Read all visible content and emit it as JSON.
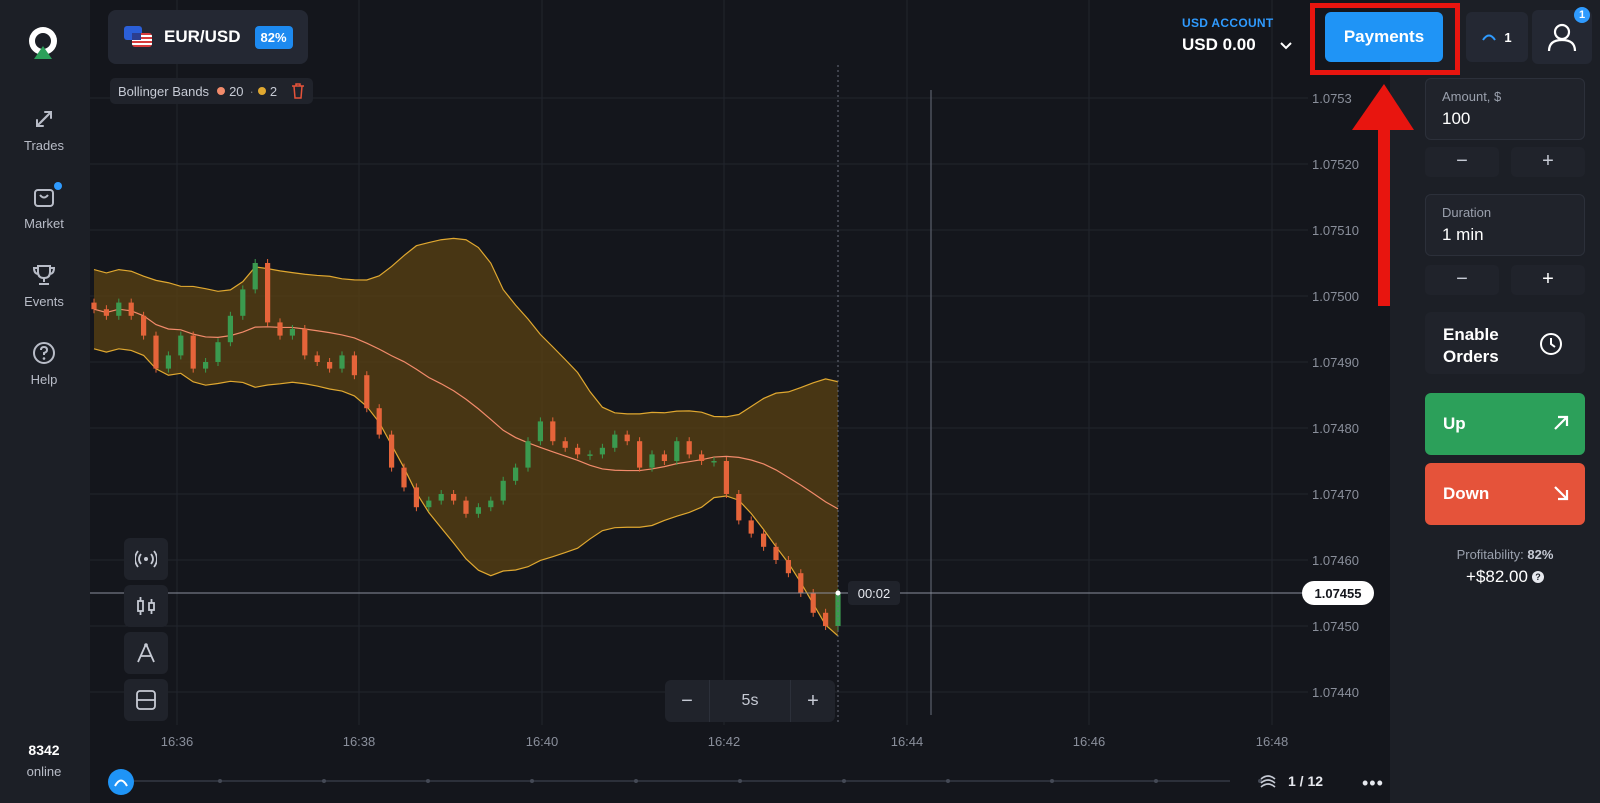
{
  "sidebar": {
    "items": [
      {
        "label": "Trades",
        "icon": "trades-arrows-icon"
      },
      {
        "label": "Market",
        "icon": "shopping-bag-icon"
      },
      {
        "label": "Events",
        "icon": "trophy-icon"
      },
      {
        "label": "Help",
        "icon": "help-circle-icon"
      }
    ],
    "online_count": "8342",
    "online_label": "online"
  },
  "header": {
    "pair": "EUR/USD",
    "payout": "82%",
    "account_label": "USD ACCOUNT",
    "account_balance": "USD 0.00",
    "payments_label": "Payments",
    "open_trades": "1",
    "notifications": "1"
  },
  "indicator": {
    "name": "Bollinger Bands",
    "period": "20",
    "deviation": "2",
    "period_color": "#f28b6b",
    "deviation_color": "#e0a830"
  },
  "trade_panel": {
    "amount_label": "Amount, $",
    "amount_value": "100",
    "duration_label": "Duration",
    "duration_value": "1 min",
    "minus": "−",
    "plus": "+",
    "enable_orders": "Enable Orders",
    "up_label": "Up",
    "down_label": "Down",
    "profitability_label": "Profitability:",
    "profitability_value": "82%",
    "profit_amount": "+$82.00",
    "up_color": "#2ca05a",
    "down_color": "#e5533a"
  },
  "chart": {
    "zoom_minus": "−",
    "zoom_value": "5s",
    "zoom_plus": "+",
    "countdown": "00:02",
    "current_price": "1.07455",
    "price_ticks": [
      "1.0753",
      "1.07520",
      "1.07510",
      "1.07500",
      "1.07490",
      "1.07480",
      "1.07470",
      "1.07460",
      "1.07450",
      "1.07440"
    ],
    "time_ticks": [
      "16:36",
      "16:38",
      "16:40",
      "16:42",
      "16:44",
      "16:46",
      "16:48"
    ],
    "page": "1 / 12"
  },
  "chart_data": {
    "type": "candlestick",
    "y_range": [
      1.07435,
      1.07535
    ],
    "x_range": [
      "16:35",
      "16:48"
    ],
    "indicator": "Bollinger Bands (20, 2)",
    "close_series": [
      1.07498,
      1.07497,
      1.07499,
      1.07497,
      1.07494,
      1.07489,
      1.07491,
      1.07494,
      1.07489,
      1.0749,
      1.07493,
      1.07497,
      1.07501,
      1.07505,
      1.07496,
      1.07494,
      1.07495,
      1.07491,
      1.0749,
      1.07489,
      1.07491,
      1.07488,
      1.07483,
      1.07479,
      1.07474,
      1.07471,
      1.07468,
      1.07469,
      1.0747,
      1.07469,
      1.07467,
      1.07468,
      1.07469,
      1.07472,
      1.07474,
      1.07478,
      1.07481,
      1.07478,
      1.07477,
      1.07476,
      1.07476,
      1.07477,
      1.07479,
      1.07478,
      1.07474,
      1.07476,
      1.07475,
      1.07478,
      1.07476,
      1.07475,
      1.07475,
      1.0747,
      1.07466,
      1.07464,
      1.07462,
      1.0746,
      1.07458,
      1.07455,
      1.07452,
      1.0745,
      1.07455
    ],
    "current_price": 1.07455,
    "current_time_label": "00:02"
  }
}
